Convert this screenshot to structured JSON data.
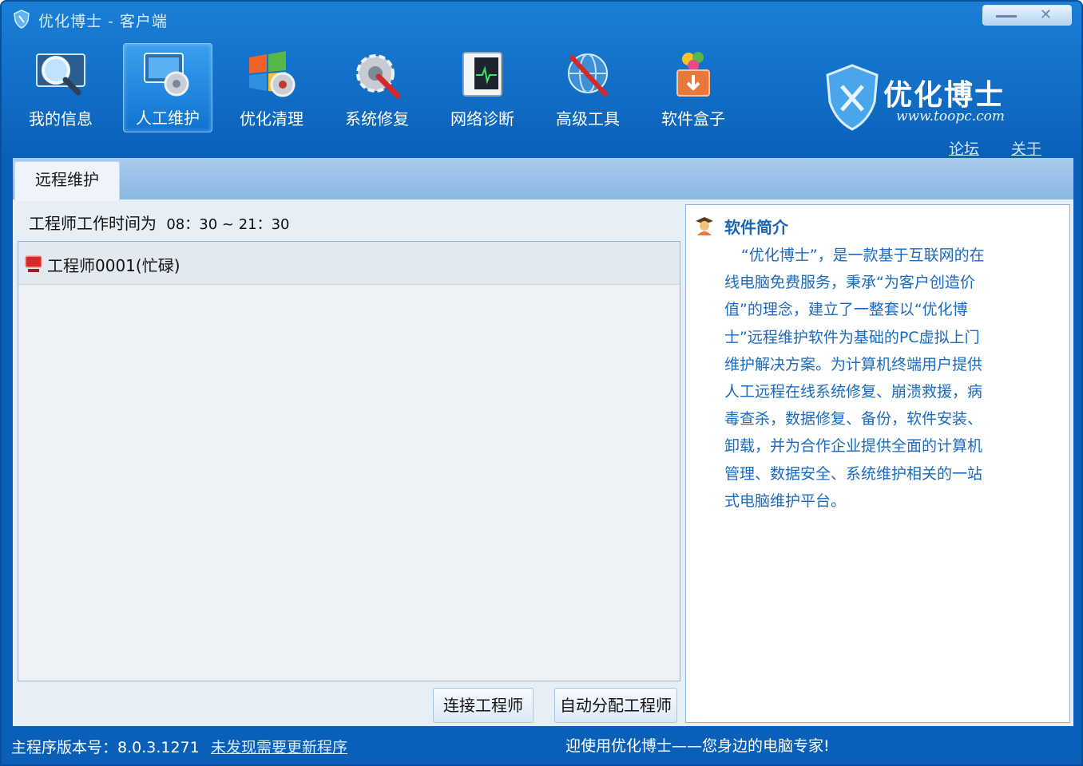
{
  "window": {
    "title": "优化博士 - 客户端"
  },
  "toolbar": {
    "items": [
      {
        "label": "我的信息",
        "icon": "magnifier-monitor-icon"
      },
      {
        "label": "人工维护",
        "icon": "monitor-gear-icon",
        "active": true
      },
      {
        "label": "优化清理",
        "icon": "windows-gear-icon"
      },
      {
        "label": "系统修复",
        "icon": "gear-wrench-icon"
      },
      {
        "label": "网络诊断",
        "icon": "network-monitor-icon"
      },
      {
        "label": "高级工具",
        "icon": "globe-tools-icon"
      },
      {
        "label": "软件盒子",
        "icon": "software-box-icon"
      }
    ]
  },
  "brand": {
    "name": "优化博士",
    "url": "www.toopc.com"
  },
  "links": {
    "forum": "论坛",
    "about": "关于"
  },
  "tabs": [
    {
      "label": "远程维护"
    }
  ],
  "engineers": {
    "hours_label": "工程师工作时间为",
    "hours_value": "08：30 ~ 21：30",
    "list": [
      {
        "name": "工程师0001(忙碌)",
        "status": "busy"
      }
    ]
  },
  "buttons": {
    "connect": "连接工程师",
    "auto_assign": "自动分配工程师"
  },
  "intro": {
    "title": "软件简介",
    "text": "“优化博士”，是一款基于互联网的在线电脑免费服务，秉承“为客户创造价值”的理念，建立了一整套以“优化博士”远程维护软件为基础的PC虚拟上门维护解决方案。为计算机终端用户提供人工远程在线系统修复、崩溃救援，病毒查杀，数据修复、备份，软件安装、卸载，并为合作企业提供全面的计算机管理、数据安全、系统维护相关的一站式电脑维护平台。"
  },
  "status": {
    "version": "主程序版本号：8.0.3.1271",
    "update": "未发现需要更新程序",
    "welcome": "迎使用优化博士——您身边的电脑专家!"
  },
  "colors": {
    "frame_blue": "#0a5fb8",
    "link_text": "#1a6ac0",
    "busy_red": "#d22a2a"
  }
}
